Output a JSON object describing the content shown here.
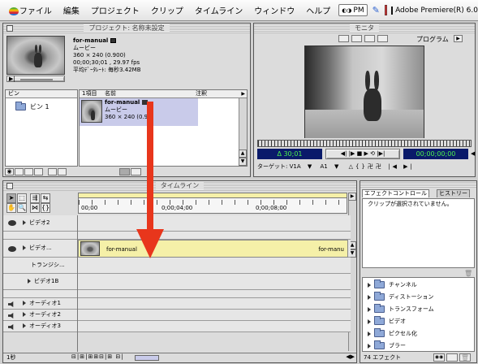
{
  "menubar": {
    "items": [
      "ファイル",
      "編集",
      "プロジェクト",
      "クリップ",
      "タイムライン",
      "ウィンドウ",
      "ヘルプ"
    ],
    "clock": "PM",
    "app_name": "Adobe Premiere(R) 6.0"
  },
  "project": {
    "title": "プロジェクト: 名称未設定",
    "preview_name": "for-manual",
    "preview_type": "ムービー",
    "preview_dims": "360 × 240 (0.900)",
    "preview_duration": "00;00;30;01 , 29.97 fps",
    "preview_rate": "平均ﾃﾞｰﾀﾚｰﾄ: 毎秒3.42MB",
    "bin_header": "ビン",
    "bin_item": "ビン 1",
    "col_count": "1項目",
    "col_name": "名前",
    "col_note": "注釈",
    "clip_name": "for-manual",
    "clip_type": "ムービー",
    "clip_dims": "360 × 240 (0.90"
  },
  "monitor": {
    "title": "モニタ",
    "program_label": "プログラム",
    "duration": "Δ 30;01",
    "timecode": "00;00;00;00",
    "target_label": "ターゲット: V1A",
    "audio_target": "A1"
  },
  "timeline": {
    "title": "タイムライン",
    "ruler": [
      "00;00",
      "0;00;04;00",
      "0;00;08;00"
    ],
    "tracks": {
      "video2": "ビデオ2",
      "video1": "ビデオ...",
      "transition": "トランジシ...",
      "video1b": "ビデオ1B",
      "audio1": "オーディオ1",
      "audio2": "オーディオ2",
      "audio3": "オーディオ3"
    },
    "clip_label": "for-manual",
    "clip_label_end": "for-manu",
    "footer_left": "1秒"
  },
  "effects": {
    "tab_effect": "エフェクトコントロール",
    "tab_history": "ヒストリー",
    "message": "クリップが選択されていません。",
    "folders": [
      "チャンネル",
      "ディストーション",
      "トランスフォーム",
      "ビデオ",
      "ピクセル化",
      "ブラー"
    ],
    "footer_count": "74 エフェクト"
  },
  "colors": {
    "clip_yellow": "#f5f0a8",
    "arrow_red": "#e8361c",
    "lcd_bg": "#0a1a6a",
    "lcd_text": "#4ef04e",
    "bin_highlight": "#c9cbea"
  }
}
